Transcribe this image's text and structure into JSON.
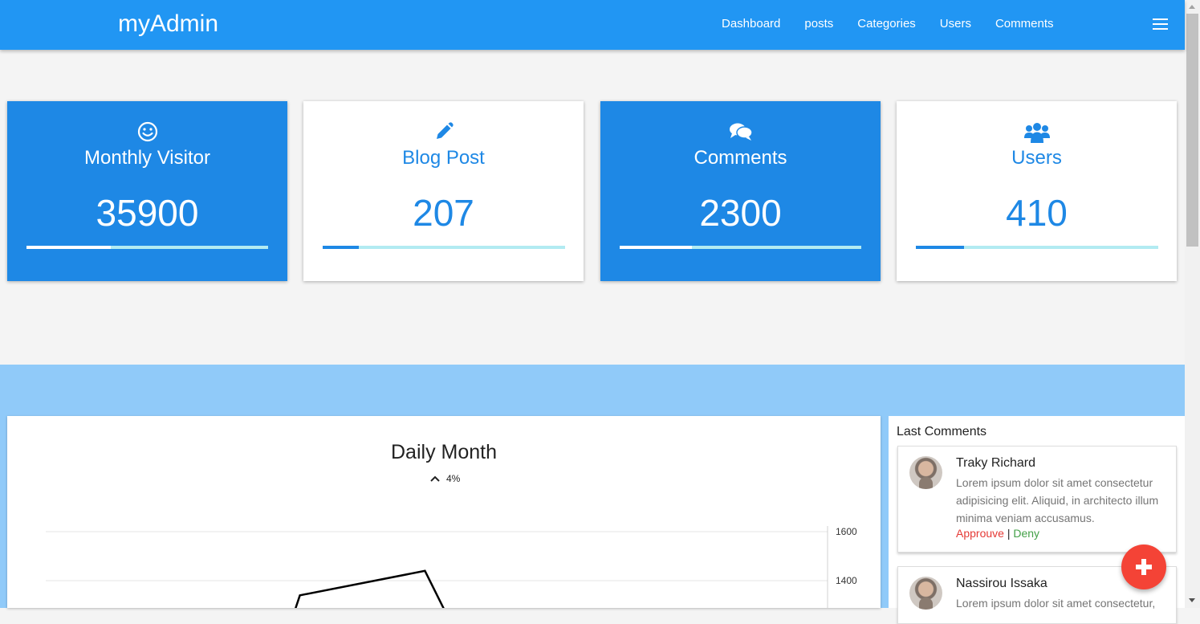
{
  "app": {
    "brand": "myAdmin"
  },
  "nav": {
    "links": [
      "Dashboard",
      "posts",
      "Categories",
      "Users",
      "Comments"
    ]
  },
  "colors": {
    "primary": "#2196f3",
    "card_blue": "#1e88e5",
    "band": "#90caf9",
    "progress_track": "#b2ebf2",
    "approve": "#e53935",
    "deny": "#43a047",
    "fab": "#f44336"
  },
  "stats": [
    {
      "title": "Monthly Visitor",
      "value": "35900",
      "icon": "smile-icon",
      "progress": 0.35
    },
    {
      "title": "Blog Post",
      "value": "207",
      "icon": "pencil-icon",
      "progress": 0.15
    },
    {
      "title": "Comments",
      "value": "2300",
      "icon": "comments-icon",
      "progress": 0.3
    },
    {
      "title": "Users",
      "value": "410",
      "icon": "users-icon",
      "progress": 0.2
    }
  ],
  "chart": {
    "title": "Daily Month",
    "change": "4%",
    "change_icon": "chevron-up-icon"
  },
  "chart_data": {
    "type": "line",
    "title": "Daily Month",
    "y_ticks": [
      "1600",
      "1400"
    ],
    "ylim_visible": [
      1200,
      1600
    ],
    "series": [
      {
        "points": [
          {
            "x": 0.3,
            "y": 1100
          },
          {
            "x": 0.325,
            "y": 1340
          },
          {
            "x": 0.485,
            "y": 1440
          },
          {
            "x": 0.51,
            "y": 1280
          }
        ]
      }
    ],
    "grid": true
  },
  "comments": {
    "heading": "Last Comments",
    "items": [
      {
        "name": "Traky Richard",
        "text": "Lorem ipsum dolor sit amet consectetur adipisicing elit. Aliquid, in architecto illum minima veniam accusamus.",
        "approve": "Approuve",
        "separator": "|",
        "deny": "Deny"
      },
      {
        "name": "Nassirou Issaka",
        "text": "Lorem ipsum dolor sit amet consectetur,"
      }
    ]
  }
}
